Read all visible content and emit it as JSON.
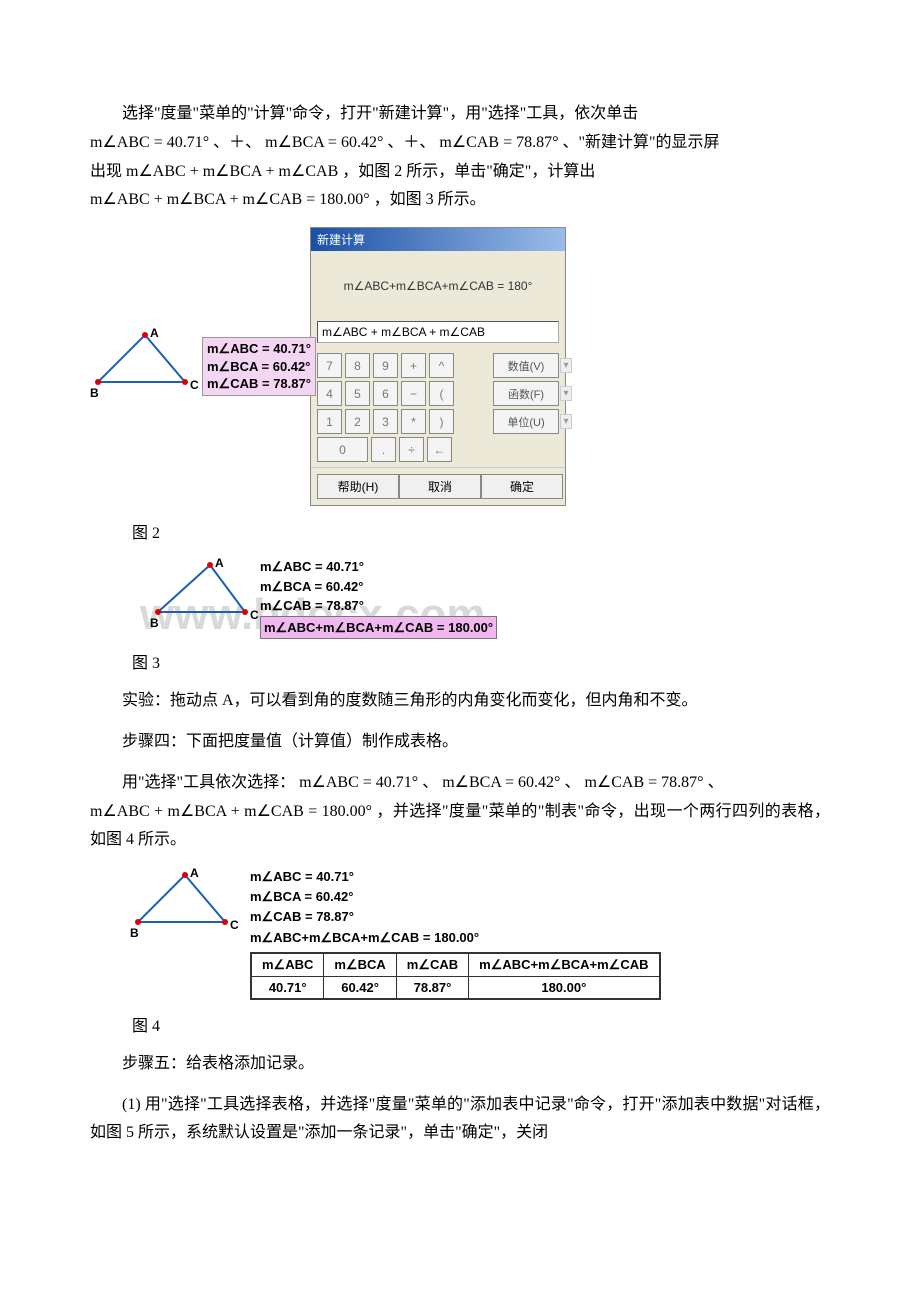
{
  "para1_a": "选择\"度量\"菜单的\"计算\"命令，打开\"新建计算\"，用\"选择\"工具，依次单击",
  "eq1": "m∠ABC = 40.71°",
  "sep": "、＋、",
  "eq2": "m∠BCA = 60.42°",
  "eq3": "m∠CAB = 78.87°",
  "para1_b": "、\"新建计算\"的显示屏",
  "para1_c": "出现",
  "eq4": "m∠ABC + m∠BCA + m∠CAB",
  "para1_d": "，如图 2 所示，单击\"确定\"，计算出",
  "eq5": "m∠ABC + m∠BCA + m∠CAB = 180.00°",
  "para1_e": "，如图 3 所示。",
  "fig2": {
    "triangle": {
      "A": "A",
      "B": "B",
      "C": "C"
    },
    "meas": [
      "m∠ABC = 40.71°",
      "m∠BCA = 60.42°",
      "m∠CAB = 78.87°"
    ],
    "dialog": {
      "title": "新建计算",
      "display": "m∠ABC+m∠BCA+m∠CAB = 180°",
      "input": "m∠ABC + m∠BCA + m∠CAB",
      "side": [
        "数值(V)",
        "函数(F)",
        "单位(U)"
      ],
      "help": "帮助(H)",
      "cancel": "取消",
      "ok": "确定"
    }
  },
  "cap2": "图 2",
  "fig3": {
    "lines": [
      "m∠ABC = 40.71°",
      "m∠BCA = 60.42°",
      "m∠CAB = 78.87°"
    ],
    "sum": "m∠ABC+m∠BCA+m∠CAB = 180.00°"
  },
  "cap3": "图 3",
  "para2": "实验：拖动点 A，可以看到角的度数随三角形的内角变化而变化，但内角和不变。",
  "para3": "步骤四：下面把度量值（计算值）制作成表格。",
  "para4_a": "用\"选择\"工具依次选择：",
  "p4e1": "m∠ABC = 40.71°",
  "p4s": "、",
  "p4e2": "m∠BCA = 60.42°",
  "p4e3": "m∠CAB = 78.87°",
  "p4e4": "m∠ABC + m∠BCA + m∠CAB = 180.00°",
  "para4_b": "，并选择\"度量\"菜单的\"制表\"命令，出现一个两行四列的表格，如图 4 所示。",
  "fig4": {
    "lines": [
      "m∠ABC = 40.71°",
      "m∠BCA = 60.42°",
      "m∠CAB = 78.87°",
      "m∠ABC+m∠BCA+m∠CAB = 180.00°"
    ]
  },
  "table": {
    "headers": [
      "m∠ABC",
      "m∠BCA",
      "m∠CAB",
      "m∠ABC+m∠BCA+m∠CAB"
    ],
    "row": [
      "40.71°",
      "60.42°",
      "78.87°",
      "180.00°"
    ]
  },
  "cap4": "图 4",
  "para5": "步骤五：给表格添加记录。",
  "para6": "(1) 用\"选择\"工具选择表格，并选择\"度量\"菜单的\"添加表中记录\"命令，打开\"添加表中数据\"对话框，如图 5 所示，系统默认设置是\"添加一条记录\"，单击\"确定\"，关闭",
  "watermark": "www.bdocx.com",
  "keys": {
    "r1": [
      "7",
      "8",
      "9",
      "+",
      "^"
    ],
    "r2": [
      "4",
      "5",
      "6",
      "−",
      "("
    ],
    "r3": [
      "1",
      "2",
      "3",
      "*",
      ")"
    ],
    "r4": [
      "0",
      ".",
      "÷",
      "←"
    ]
  }
}
